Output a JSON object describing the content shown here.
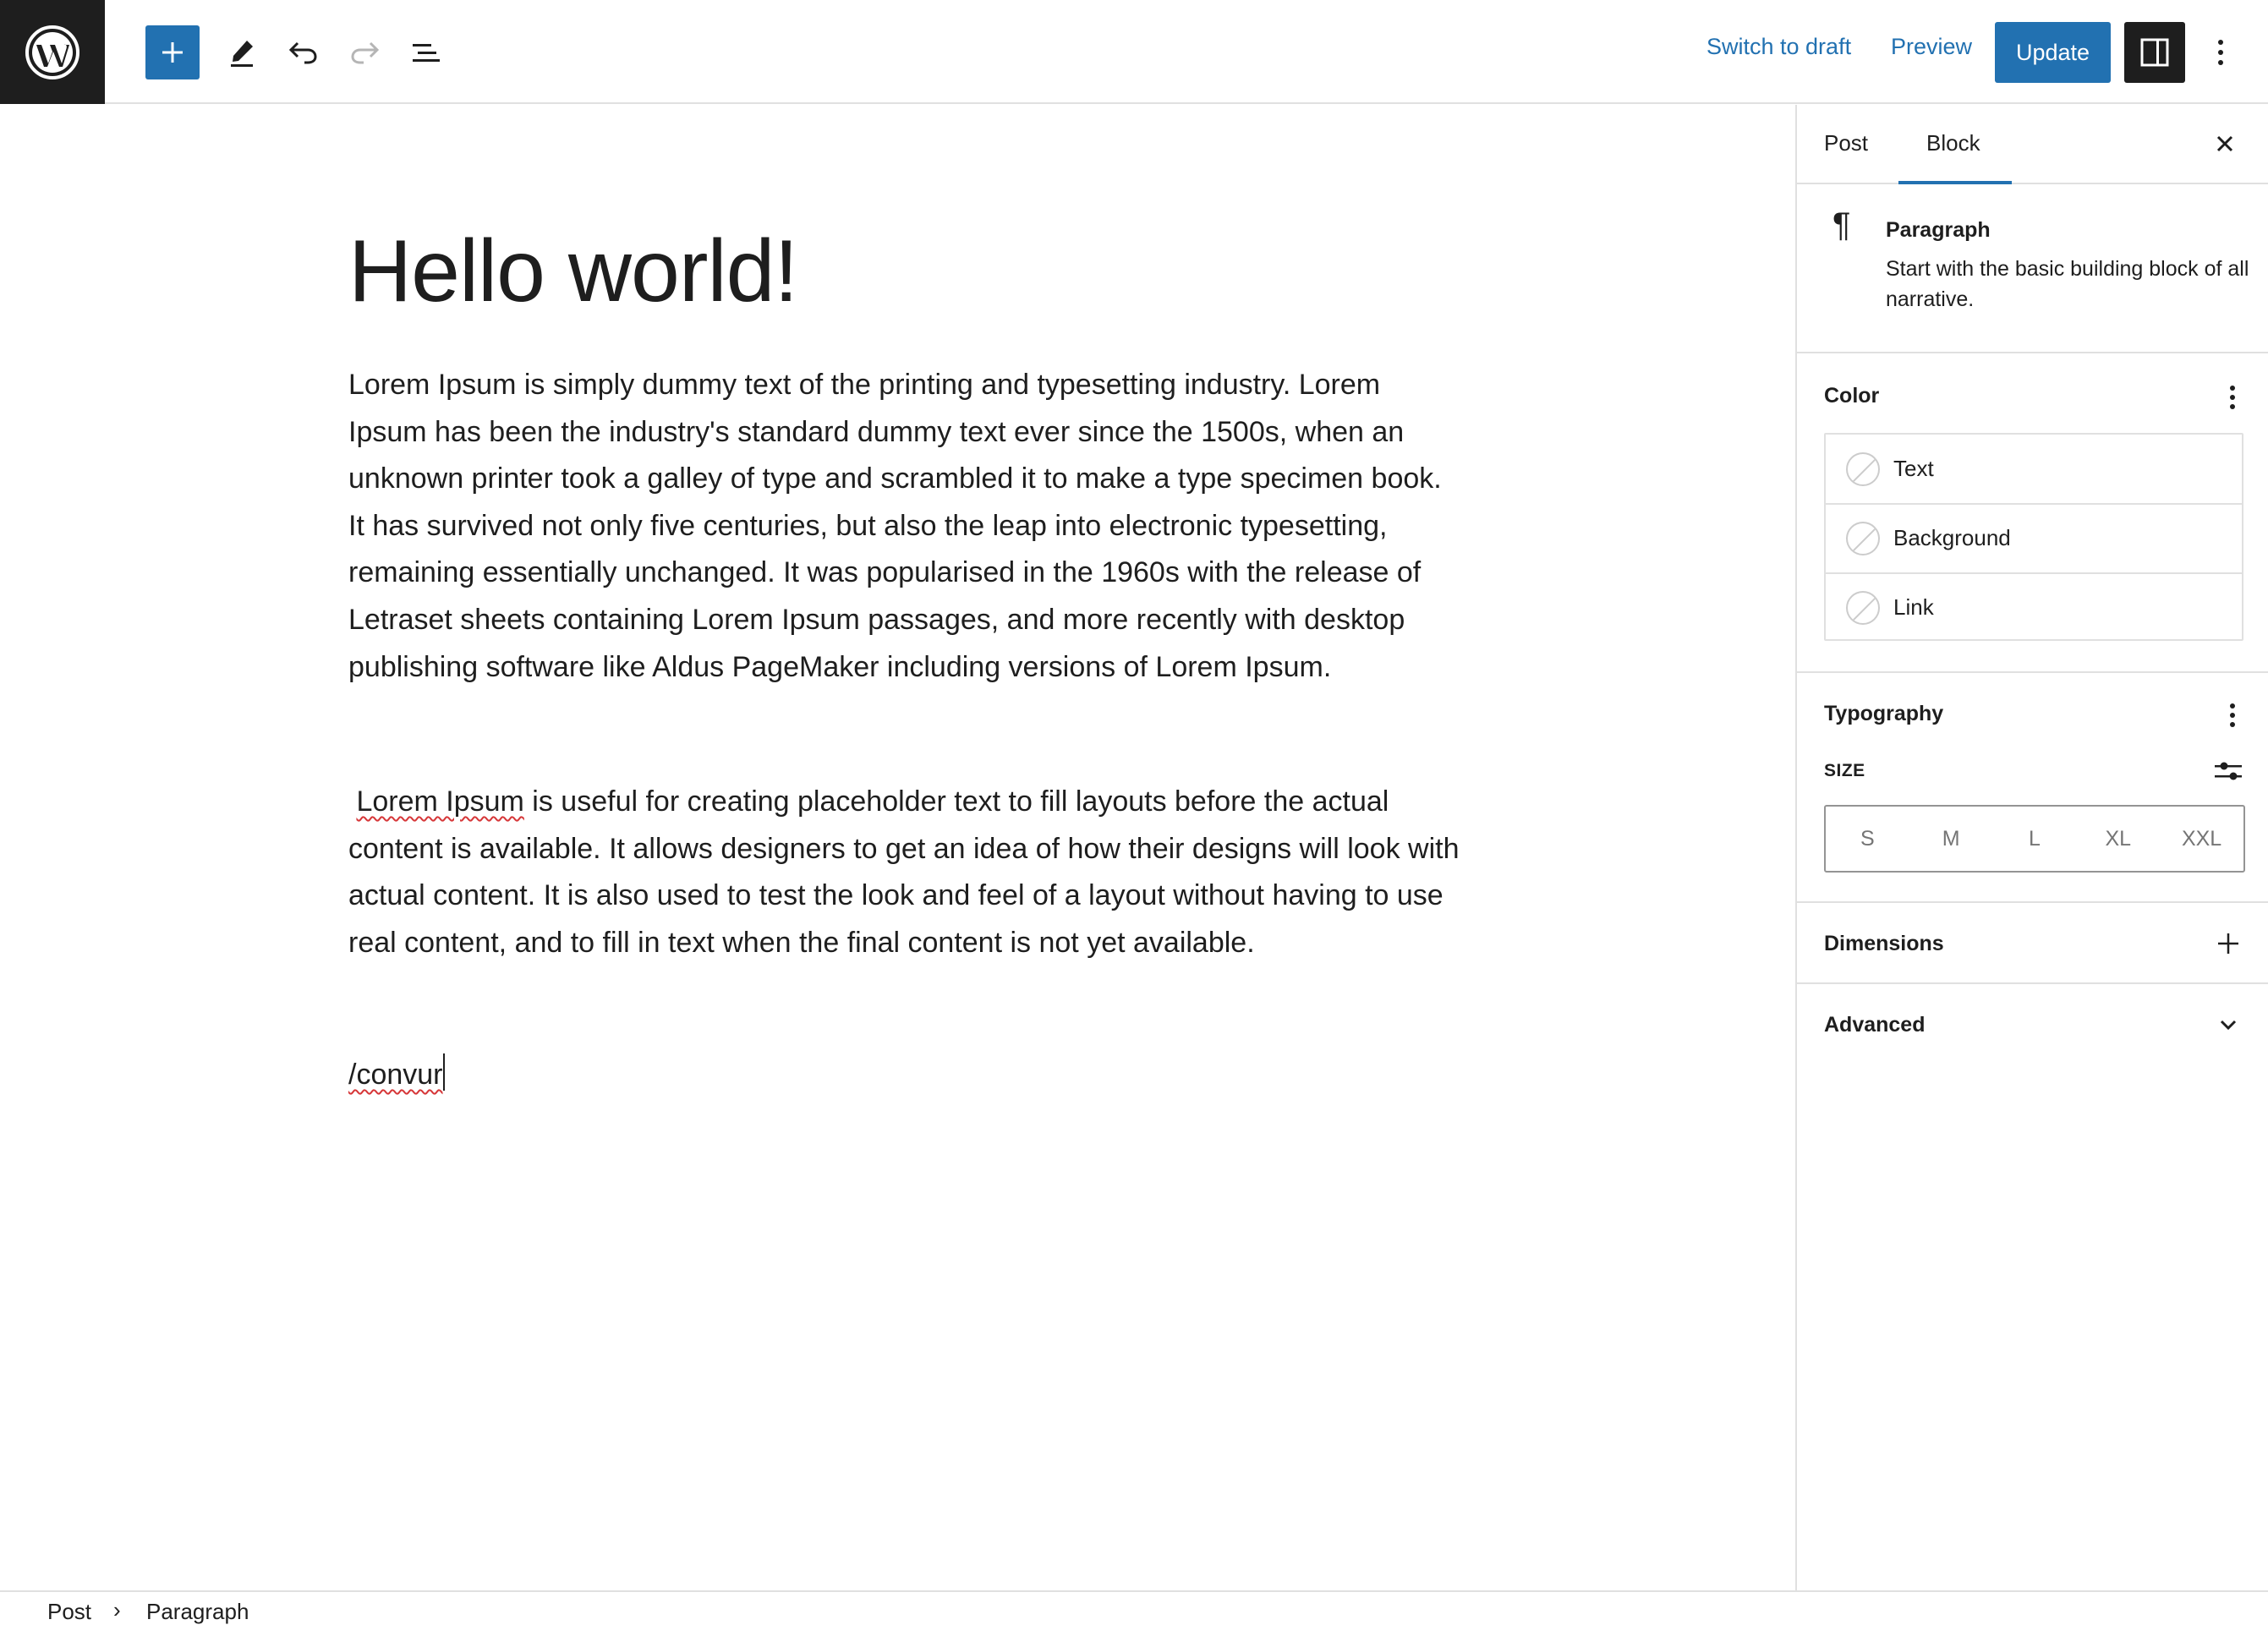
{
  "topbar": {
    "switch_to_draft": "Switch to draft",
    "preview": "Preview",
    "update": "Update",
    "icons": [
      "wordpress-logo",
      "plus",
      "pencil",
      "undo",
      "redo",
      "list-view",
      "sidebar-toggle",
      "vertical-ellipsis"
    ]
  },
  "editor": {
    "title": "Hello world!",
    "paragraph1": "Lorem Ipsum is simply dummy text of the printing and typesetting industry. Lorem Ipsum has been the industry's standard dummy text ever since the 1500s, when an unknown printer took a galley of type and scrambled it to make a type specimen book. It has survived not only five centuries, but also the leap into electronic typesetting, remaining essentially unchanged. It was popularised in the 1960s with the release of Letraset sheets containing Lorem Ipsum passages, and more recently with desktop publishing software like Aldus PageMaker including versions of Lorem Ipsum.",
    "paragraph2_lead": "Lorem Ipsum",
    "paragraph2_rest": " is useful for creating placeholder text to fill layouts before the actual content is available. It allows designers to get an idea of how their designs will look with actual content. It is also used to test the look and feel of a layout without having to use real content, and to fill in text when the final content is not yet available.",
    "paragraph3": "/convur"
  },
  "sidebar": {
    "tabs": {
      "post": "Post",
      "block": "Block",
      "active": "Block"
    },
    "block_card": {
      "name": "Paragraph",
      "description": "Start with the basic building block of all narrative."
    },
    "color": {
      "title": "Color",
      "items": [
        "Text",
        "Background",
        "Link"
      ]
    },
    "typography": {
      "title": "Typography",
      "size_label": "SIZE",
      "sizes": [
        "S",
        "M",
        "L",
        "XL",
        "XXL"
      ]
    },
    "dimensions": {
      "title": "Dimensions"
    },
    "advanced": {
      "title": "Advanced"
    }
  },
  "footer": {
    "breadcrumb": [
      "Post",
      "Paragraph"
    ]
  },
  "colors": {
    "accent": "#2271b1",
    "dark": "#1e1e1e",
    "border": "#e0e0e0",
    "spellcheck": "#d63638"
  }
}
